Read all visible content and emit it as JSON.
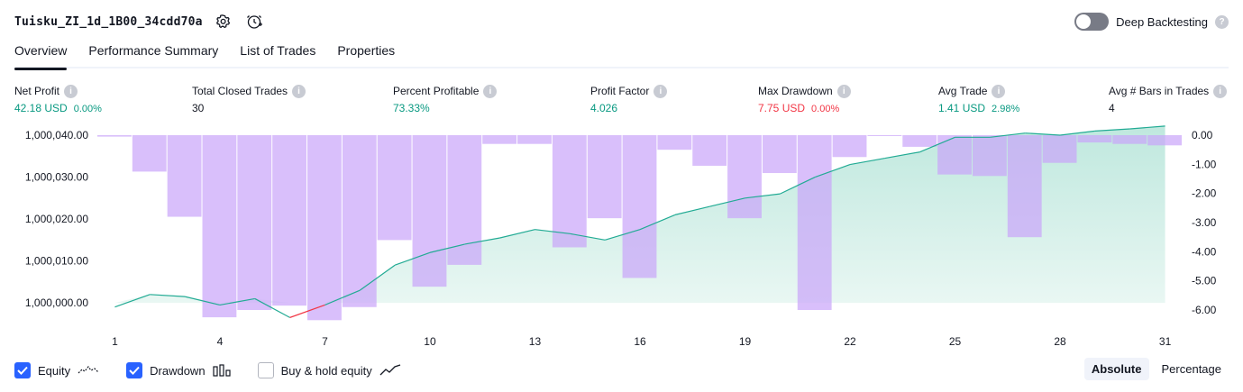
{
  "header": {
    "strategy_name": "Tuisku_ZI_1d_1B00_34cdd70a",
    "settings_icon": "gear-icon",
    "alert_icon": "add-alert-clock-icon",
    "deep_backtesting_label": "Deep Backtesting",
    "deep_backtesting_enabled": false
  },
  "tabs": [
    {
      "label": "Overview",
      "active": true
    },
    {
      "label": "Performance Summary",
      "active": false
    },
    {
      "label": "List of Trades",
      "active": false
    },
    {
      "label": "Properties",
      "active": false
    }
  ],
  "metrics": [
    {
      "label": "Net Profit",
      "value": "42.18 USD",
      "sub": "0.00%",
      "color": "#089981"
    },
    {
      "label": "Total Closed Trades",
      "value": "30",
      "sub": "",
      "color": "#131722"
    },
    {
      "label": "Percent Profitable",
      "value": "73.33%",
      "sub": "",
      "color": "#089981"
    },
    {
      "label": "Profit Factor",
      "value": "4.026",
      "sub": "",
      "color": "#089981"
    },
    {
      "label": "Max Drawdown",
      "value": "7.75 USD",
      "sub": "0.00%",
      "color": "#f23645"
    },
    {
      "label": "Avg Trade",
      "value": "1.41 USD",
      "sub": "2.98%",
      "color": "#089981"
    },
    {
      "label": "Avg # Bars in Trades",
      "value": "4",
      "sub": "",
      "color": "#131722"
    }
  ],
  "chart_data": {
    "type": "line",
    "x": [
      1,
      2,
      3,
      4,
      5,
      6,
      7,
      8,
      9,
      10,
      11,
      12,
      13,
      14,
      15,
      16,
      17,
      18,
      19,
      20,
      21,
      22,
      23,
      24,
      25,
      26,
      27,
      28,
      29,
      30,
      31
    ],
    "x_tick_labels": [
      "1",
      "4",
      "7",
      "10",
      "13",
      "16",
      "19",
      "22",
      "25",
      "28",
      "31"
    ],
    "series": [
      {
        "type": "area",
        "axis": "left",
        "values": [
          999999.0,
          1000002.0,
          1000001.5,
          999999.5,
          1000001.0,
          999996.5,
          999999.5,
          1000003.0,
          1000009.0,
          1000012.0,
          1000014.0,
          1000015.5,
          1000017.5,
          1000016.5,
          1000015.0,
          1000017.5,
          1000021.0,
          1000023.0,
          1000025.0,
          1000026.0,
          1000030.0,
          1000033.0,
          1000034.5,
          1000036.0,
          1000039.5,
          1000039.5,
          1000040.5,
          1000040.0,
          1000041.0,
          1000041.5,
          1000042.18
        ],
        "colors": {
          "line": "#22ab94",
          "fill": "#d6f0ea",
          "below_initial": "#f23645"
        }
      },
      {
        "type": "bar",
        "axis": "right",
        "values": [
          -0.05,
          -1.25,
          -2.8,
          -6.25,
          -6.0,
          -5.85,
          -6.35,
          -5.9,
          -3.6,
          -5.2,
          -4.45,
          -0.3,
          -0.3,
          -3.85,
          -2.85,
          -4.9,
          -0.5,
          -1.05,
          -2.85,
          -1.3,
          -6.0,
          -0.75,
          0,
          -0.4,
          -1.35,
          -1.4,
          -3.5,
          -0.95,
          -0.25,
          -0.3,
          -0.35
        ],
        "color": "#c9a4fa"
      }
    ],
    "left_axis": {
      "ticks": [
        "1,000,040.00",
        "1,000,030.00",
        "1,000,020.00",
        "1,000,010.00",
        "1,000,000.00"
      ],
      "range": [
        999998.3,
        1000040.0
      ]
    },
    "right_axis": {
      "ticks": [
        "0.00",
        "-1.00",
        "-2.00",
        "-3.00",
        "-4.00",
        "-5.00",
        "-6.00"
      ],
      "range": [
        -6.0,
        0.0
      ]
    },
    "grid": false
  },
  "legend": [
    {
      "label": "Equity",
      "checked": true,
      "icon": "equity-line-icon"
    },
    {
      "label": "Drawdown",
      "checked": true,
      "icon": "drawdown-bars-icon"
    },
    {
      "label": "Buy & hold equity",
      "checked": false,
      "icon": "buy-hold-line-icon"
    }
  ],
  "mode_buttons": [
    {
      "label": "Absolute",
      "active": true
    },
    {
      "label": "Percentage",
      "active": false
    }
  ]
}
